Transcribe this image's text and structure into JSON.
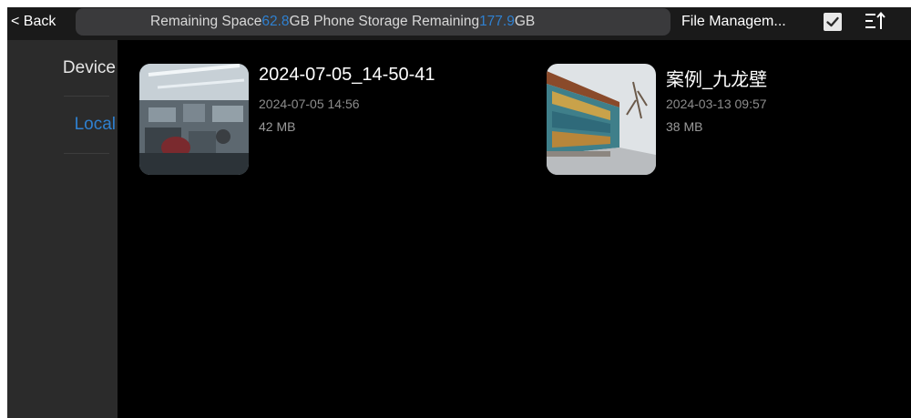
{
  "header": {
    "back_label": "< Back",
    "storage": {
      "remaining_label": "Remaining Space",
      "remaining_value": "62.8",
      "remaining_unit": "GB",
      "phone_label": " Phone Storage Remaining",
      "phone_value": "177.9",
      "phone_unit": "GB"
    },
    "file_management_label": "File Managem...",
    "select_icon": "checkbox-checked-icon",
    "sort_icon": "sort-icon"
  },
  "sidebar": {
    "items": [
      {
        "label": "Device",
        "active": false
      },
      {
        "label": "Local",
        "active": true
      }
    ],
    "active_color": "#2f80d0"
  },
  "files": [
    {
      "title": "2024-07-05_14-50-41",
      "date": "2024-07-05 14:56",
      "size": "42 MB",
      "thumbnail": "office-video-thumbnail"
    },
    {
      "title": "案例_九龙壁",
      "date": "2024-03-13 09:57",
      "size": "38 MB",
      "thumbnail": "nine-dragon-wall-thumbnail"
    }
  ]
}
